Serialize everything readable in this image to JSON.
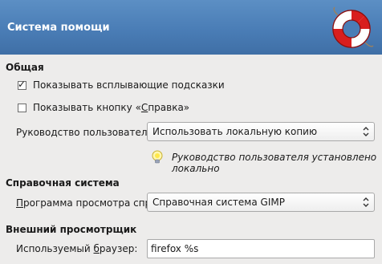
{
  "header": {
    "title": "Система помощи"
  },
  "general": {
    "title": "Общая",
    "tooltips": {
      "label": "Показывать всплывающие подсказки",
      "checked": true
    },
    "help_button": {
      "label_before": "Показывать кнопку «",
      "label_mnemonic": "С",
      "label_after": "правка»",
      "checked": false
    },
    "manual": {
      "label": "Руководство пользователя:",
      "value": "Использовать локальную копию",
      "info": "Руководство пользователя установлено локально"
    }
  },
  "help_system": {
    "title": "Справочная система",
    "viewer": {
      "label_mnemonic": "П",
      "label_rest": "рограмма просмотра справки:",
      "value": "Справочная система GIMP"
    }
  },
  "external_browser": {
    "title": "Внешний просмотрщик",
    "browser": {
      "label_before": "Используемый ",
      "label_mnemonic": "б",
      "label_after": "раузер:",
      "value": "firefox %s"
    }
  },
  "icons": {
    "header": "lifebuoy-icon",
    "info": "lightbulb-info-icon",
    "combo": "updown-arrows-icon"
  }
}
